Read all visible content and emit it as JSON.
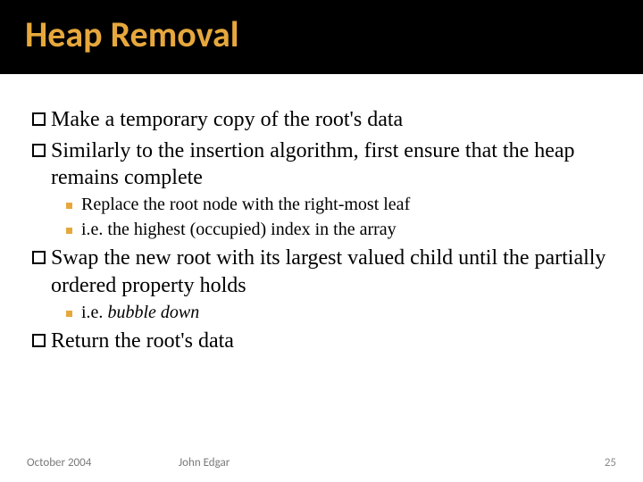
{
  "title": "Heap Removal",
  "bullets": {
    "b1": "Make a temporary copy of the root's data",
    "b2": "Similarly to the insertion algorithm, first ensure that the heap remains complete",
    "b2_sub1": "Replace the root node with the right-most leaf",
    "b2_sub2": "i.e. the highest (occupied) index in the array",
    "b3": "Swap the new root with its largest valued child until the partially ordered property holds",
    "b3_sub1_prefix": "i.e. ",
    "b3_sub1_italic": "bubble down",
    "b4": "Return the root's data"
  },
  "footer": {
    "date": "October 2004",
    "author": "John Edgar",
    "page": "25"
  }
}
